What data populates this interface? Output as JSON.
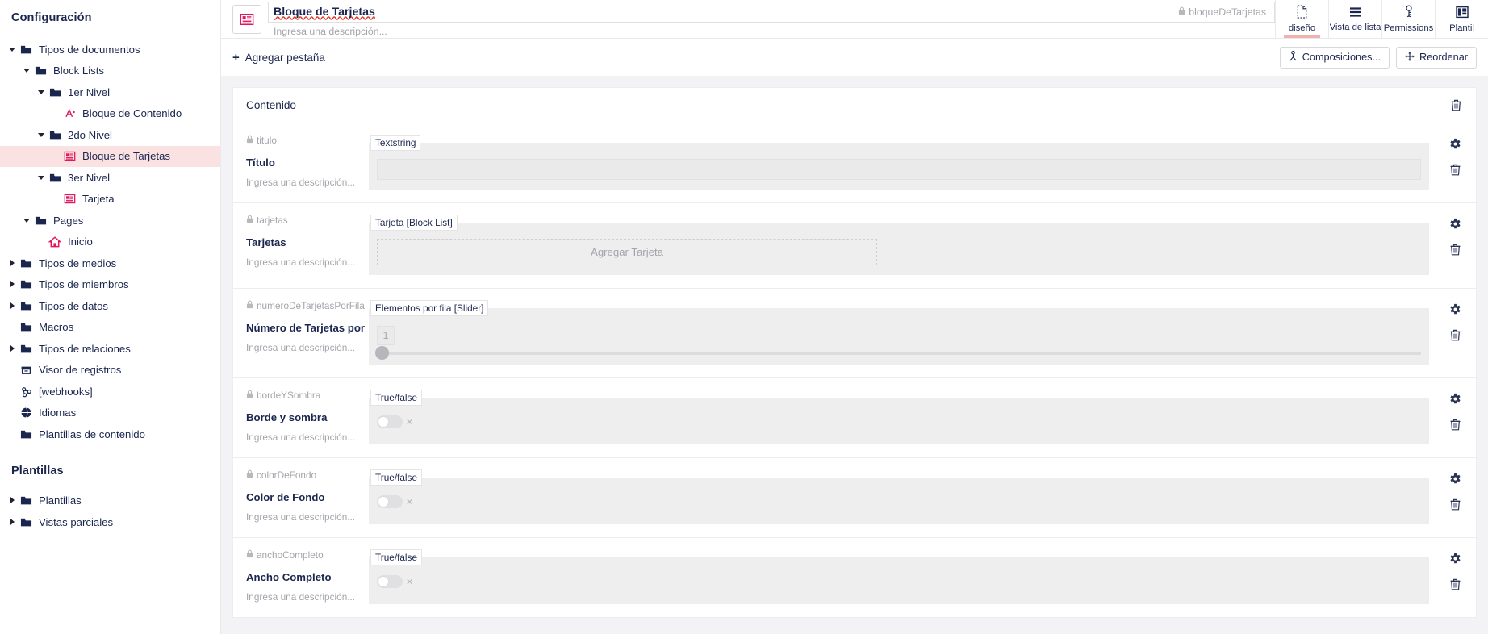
{
  "sidebar": {
    "heading_settings": "Configuración",
    "heading_templates": "Plantillas",
    "tree": [
      {
        "label": "Tipos de documentos",
        "icon": "folder-icon",
        "caret": "down",
        "indent": 0,
        "selected": false
      },
      {
        "label": "Block Lists",
        "icon": "folder-icon",
        "caret": "down",
        "indent": 1,
        "selected": false
      },
      {
        "label": "1er Nivel",
        "icon": "folder-icon",
        "caret": "down",
        "indent": 2,
        "selected": false
      },
      {
        "label": "Bloque de Contenido",
        "icon": "element-icon",
        "caret": "none",
        "indent": 3,
        "selected": false
      },
      {
        "label": "2do Nivel",
        "icon": "folder-icon",
        "caret": "down",
        "indent": 2,
        "selected": false
      },
      {
        "label": "Bloque de Tarjetas",
        "icon": "doctype-icon",
        "caret": "none",
        "indent": 3,
        "selected": true
      },
      {
        "label": "3er Nivel",
        "icon": "folder-icon",
        "caret": "down",
        "indent": 2,
        "selected": false
      },
      {
        "label": "Tarjeta",
        "icon": "doctype-icon",
        "caret": "none",
        "indent": 3,
        "selected": false
      },
      {
        "label": "Pages",
        "icon": "folder-icon",
        "caret": "down",
        "indent": 1,
        "selected": false
      },
      {
        "label": "Inicio",
        "icon": "home-icon",
        "caret": "none",
        "indent": 2,
        "selected": false
      },
      {
        "label": "Tipos de medios",
        "icon": "folder-icon",
        "caret": "right",
        "indent": 0,
        "selected": false
      },
      {
        "label": "Tipos de miembros",
        "icon": "folder-icon",
        "caret": "right",
        "indent": 0,
        "selected": false
      },
      {
        "label": "Tipos de datos",
        "icon": "folder-icon",
        "caret": "right",
        "indent": 0,
        "selected": false
      },
      {
        "label": "Macros",
        "icon": "folder-icon",
        "caret": "none",
        "indent": 0,
        "selected": false
      },
      {
        "label": "Tipos de relaciones",
        "icon": "folder-icon",
        "caret": "right",
        "indent": 0,
        "selected": false
      },
      {
        "label": "Visor de registros",
        "icon": "archive-icon",
        "caret": "none",
        "indent": 0,
        "selected": false
      },
      {
        "label": "[webhooks]",
        "icon": "webhook-icon",
        "caret": "none",
        "indent": 0,
        "selected": false
      },
      {
        "label": "Idiomas",
        "icon": "globe-icon",
        "caret": "none",
        "indent": 0,
        "selected": false
      },
      {
        "label": "Plantillas de contenido",
        "icon": "folder-icon",
        "caret": "none",
        "indent": 0,
        "selected": false
      }
    ],
    "tree_templates": [
      {
        "label": "Plantillas",
        "icon": "folder-icon",
        "caret": "right",
        "indent": 0,
        "selected": false
      },
      {
        "label": "Vistas parciales",
        "icon": "folder-icon",
        "caret": "right",
        "indent": 0,
        "selected": false
      }
    ]
  },
  "header": {
    "title": "Bloque de Tarjetas",
    "description_placeholder": "Ingresa una descripción...",
    "alias": "bloqueDeTarjetas",
    "tabs": [
      {
        "label": "diseño",
        "icon": "document-outline-icon",
        "active": true
      },
      {
        "label": "Vista de lista",
        "icon": "list-icon",
        "active": false
      },
      {
        "label": "Permissions",
        "icon": "key-icon",
        "active": false
      },
      {
        "label": "Plantil",
        "icon": "template-icon",
        "active": false
      }
    ]
  },
  "actionbar": {
    "add_tab_label": "Agregar pestaña",
    "compositions_label": "Composiciones...",
    "reorder_label": "Reordenar"
  },
  "group": {
    "title": "Contenido",
    "properties": [
      {
        "alias": "titulo",
        "name": "Título",
        "description_placeholder": "Ingresa una descripción...",
        "editor": "Textstring",
        "control": "textbox",
        "value": ""
      },
      {
        "alias": "tarjetas",
        "name": "Tarjetas",
        "description_placeholder": "Ingresa una descripción...",
        "editor": "Tarjeta [Block List]",
        "control": "blocklist",
        "add_label": "Agregar Tarjeta"
      },
      {
        "alias": "numeroDeTarjetasPorFila",
        "name": "Número de Tarjetas por",
        "description_placeholder": "Ingresa una descripción...",
        "editor": "Elementos por fila [Slider]",
        "control": "slider",
        "value": "1"
      },
      {
        "alias": "bordeYSombra",
        "name": "Borde y sombra",
        "description_placeholder": "Ingresa una descripción...",
        "editor": "True/false",
        "control": "toggle",
        "value": "off"
      },
      {
        "alias": "colorDeFondo",
        "name": "Color de Fondo",
        "description_placeholder": "Ingresa una descripción...",
        "editor": "True/false",
        "control": "toggle",
        "value": "off"
      },
      {
        "alias": "anchoCompleto",
        "name": "Ancho Completo",
        "description_placeholder": "Ingresa una descripción...",
        "editor": "True/false",
        "control": "toggle",
        "value": "off"
      }
    ]
  },
  "colors": {
    "accent": "#e1185f",
    "navy": "#1b264f",
    "selected_row": "#fbe2e2",
    "tab_underline": "#f0b1ae",
    "canvas": "#f3f3f5"
  }
}
